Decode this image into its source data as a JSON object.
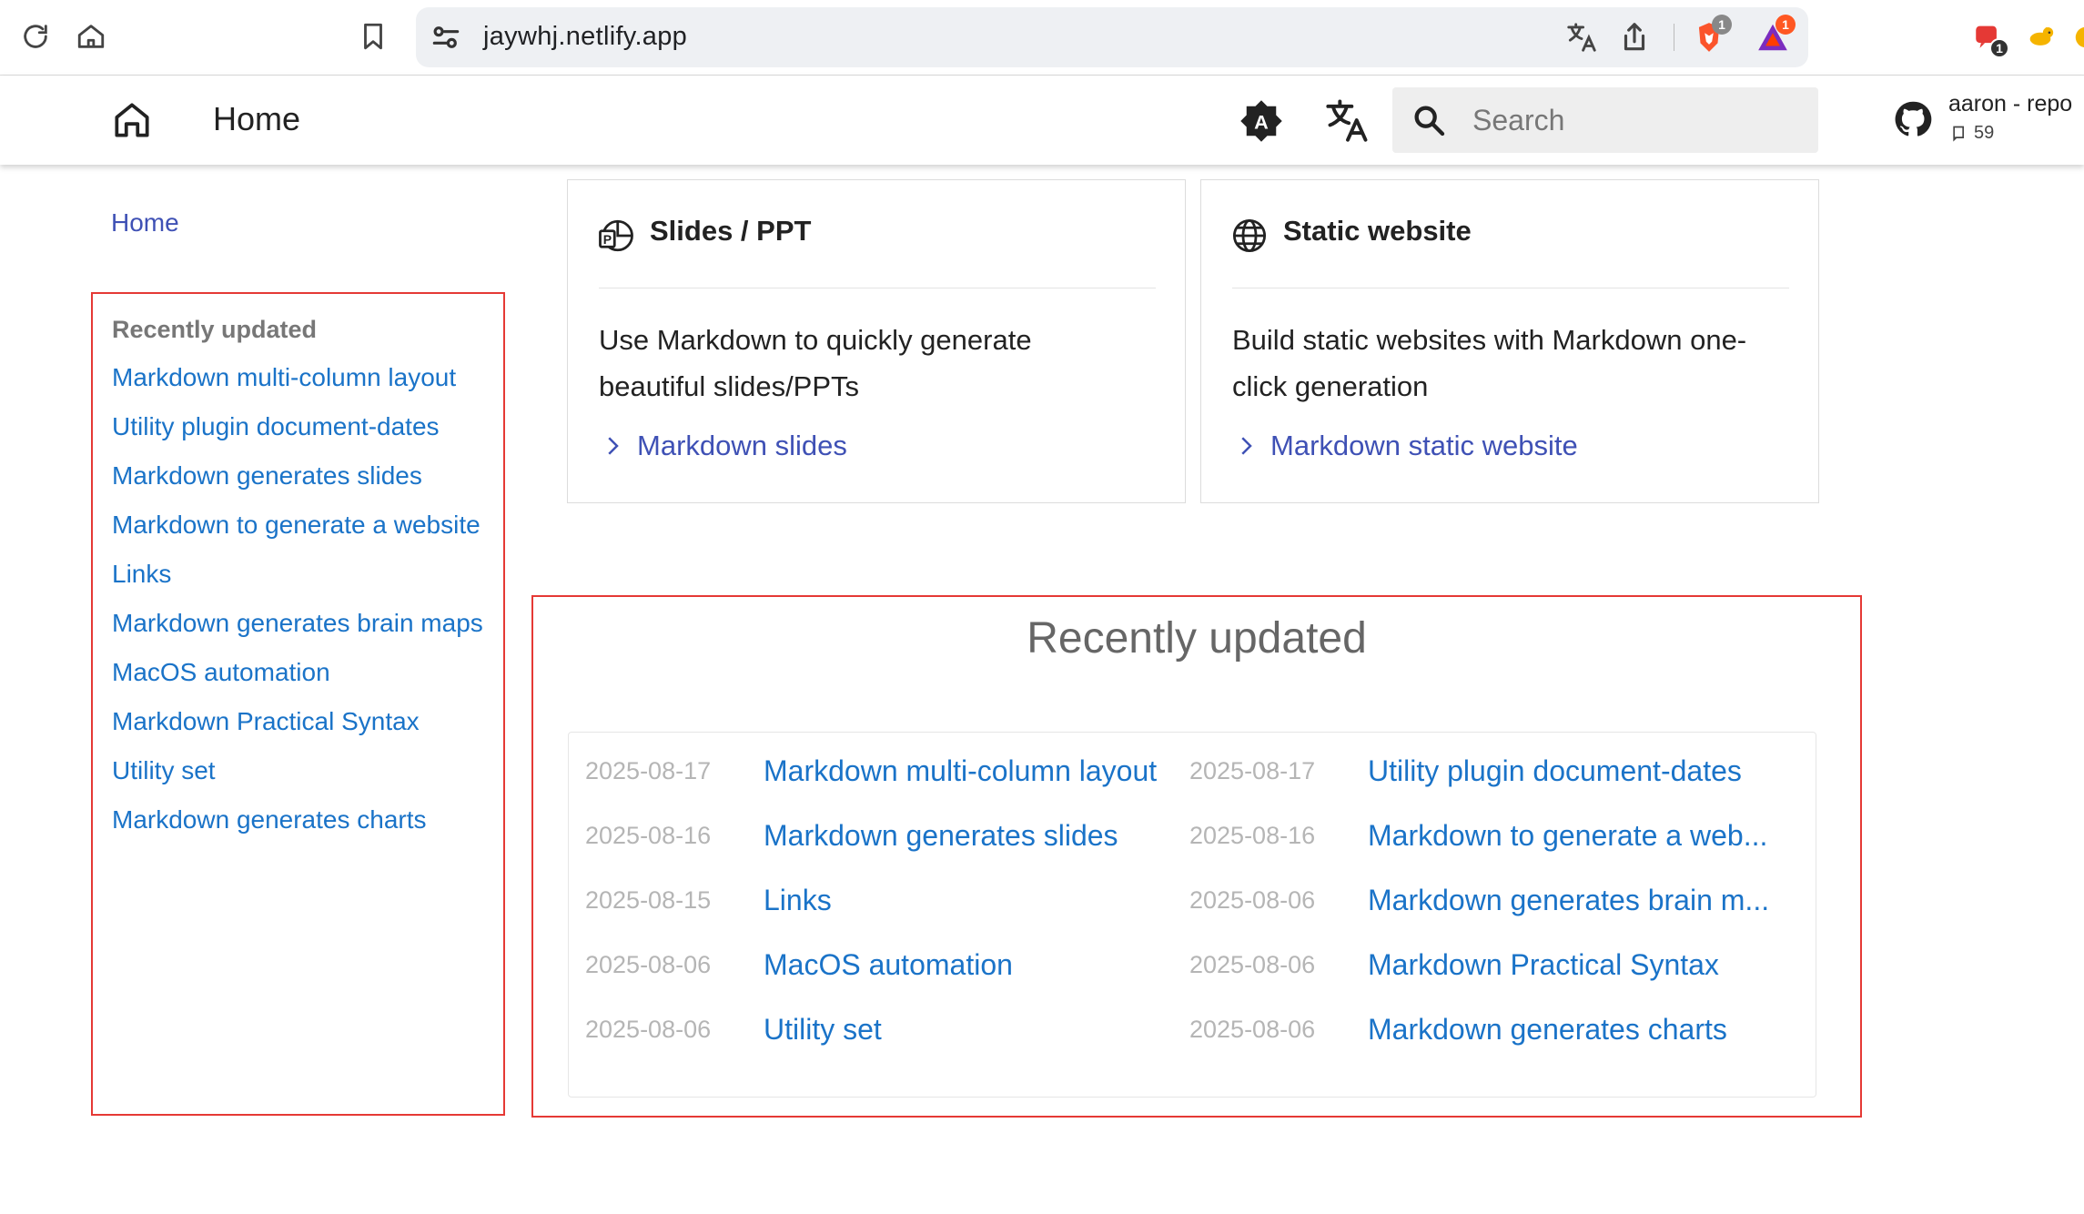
{
  "browser": {
    "url": "jaywhj.netlify.app",
    "brave_badge": "1",
    "rewards_badge": "1",
    "ext_badge": "1"
  },
  "header": {
    "title": "Home",
    "search_placeholder": "Search",
    "repo_name": "aaron - repo",
    "repo_stars": "59"
  },
  "breadcrumb": {
    "home": "Home"
  },
  "sidebar": {
    "heading": "Recently updated",
    "items": [
      "Markdown multi-column layout",
      "Utility plugin document-dates",
      "Markdown generates slides",
      "Markdown to generate a website",
      "Links",
      "Markdown generates brain maps",
      "MacOS automation",
      "Markdown Practical Syntax",
      "Utility set",
      "Markdown generates charts"
    ]
  },
  "cards": [
    {
      "title": "Slides / PPT",
      "desc_line1": "Use Markdown to quickly generate",
      "desc_line2": "beautiful slides/PPTs",
      "link": "Markdown slides"
    },
    {
      "title": "Static website",
      "desc_line1": "Build static websites with Markdown one-",
      "desc_line2": "click generation",
      "link": "Markdown static website"
    }
  ],
  "recent": {
    "title": "Recently updated",
    "left": [
      {
        "date": "2025-08-17",
        "title": "Markdown multi-column layout"
      },
      {
        "date": "2025-08-16",
        "title": "Markdown generates slides"
      },
      {
        "date": "2025-08-15",
        "title": "Links"
      },
      {
        "date": "2025-08-06",
        "title": "MacOS automation"
      },
      {
        "date": "2025-08-06",
        "title": "Utility set"
      }
    ],
    "right": [
      {
        "date": "2025-08-17",
        "title": "Utility plugin document-dates"
      },
      {
        "date": "2025-08-16",
        "title": "Markdown to generate a web..."
      },
      {
        "date": "2025-08-06",
        "title": "Markdown generates brain m..."
      },
      {
        "date": "2025-08-06",
        "title": "Markdown Practical Syntax"
      },
      {
        "date": "2025-08-06",
        "title": "Markdown generates charts"
      }
    ]
  }
}
